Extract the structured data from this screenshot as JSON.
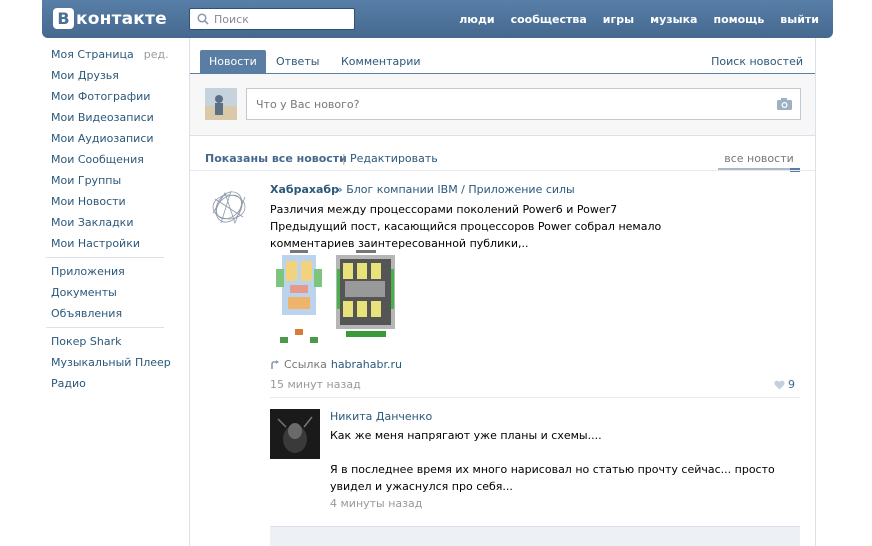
{
  "header": {
    "logo_letter": "В",
    "logo_text": "контакте",
    "search_placeholder": "Поиск",
    "nav": [
      "люди",
      "сообщества",
      "игры",
      "музыка",
      "помощь",
      "выйти"
    ]
  },
  "leftmenu": {
    "edit_label": "ред.",
    "group1": [
      "Моя Страница",
      "Мои Друзья",
      "Мои Фотографии",
      "Мои Видеозаписи",
      "Мои Аудиозаписи",
      "Мои Сообщения",
      "Мои Группы",
      "Мои Новости",
      "Мои Закладки",
      "Мои Настройки"
    ],
    "group2": [
      "Приложения",
      "Документы",
      "Объявления"
    ],
    "group3": [
      "Покер Shark",
      "Музыкальный Плеер",
      "Радио"
    ]
  },
  "tabs": {
    "items": [
      "Новости",
      "Ответы",
      "Комментарии"
    ],
    "active": "Новости",
    "search": "Поиск новостей"
  },
  "compose": {
    "placeholder": "Что у Вас нового?"
  },
  "feedbar": {
    "shown": "Показаны все новости",
    "separator": "|",
    "edit": "Редактировать",
    "tab": "все новости"
  },
  "post": {
    "author": "Хабрахабр",
    "source": "» Блог компании IBM / Приложение силы",
    "text": "Различия между процессорами поколений Power6 и Power7 Предыдущий пост, касающийся процессоров Power собрал немало комментариев заинтересованной публики,..",
    "link_label": "Ссылка",
    "link_url": "habrahabr.ru",
    "time": "15 минут назад",
    "likes": "9"
  },
  "comment": {
    "author": "Никита Данченко",
    "text": "Как же меня напрягают уже планы и схемы....\n\nЯ в последнее время их много нарисовал но статью прочту сейчас... просто увидел и ужаснулся про себя...",
    "time": "4 минуты назад"
  },
  "colors": {
    "header": "#4b6f95",
    "link": "#2b587a",
    "active_tab": "#597da3"
  }
}
